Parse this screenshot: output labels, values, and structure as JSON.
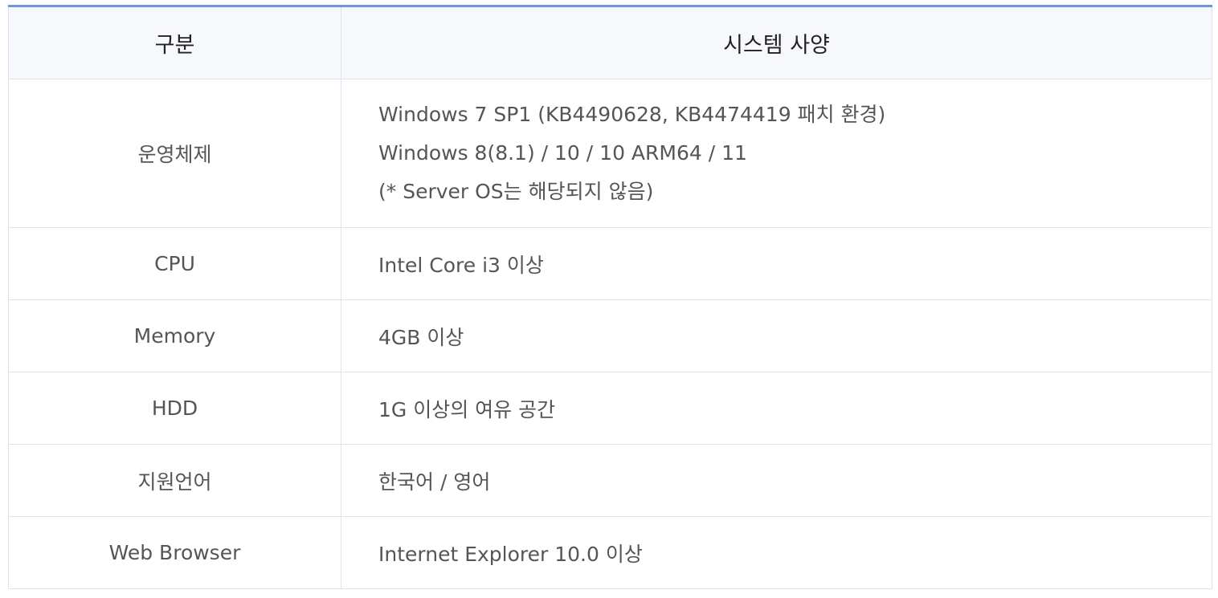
{
  "table": {
    "headers": [
      "구분",
      "시스템 사양"
    ],
    "rows": [
      {
        "label": "운영체제",
        "lines": [
          "Windows 7 SP1 (KB4490628, KB4474419 패치 환경)",
          "Windows 8(8.1) / 10 / 10 ARM64 / 11",
          "(* Server OS는 해당되지 않음)"
        ]
      },
      {
        "label": "CPU",
        "value": "Intel Core i3 이상"
      },
      {
        "label": "Memory",
        "value": "4GB 이상"
      },
      {
        "label": "HDD",
        "value": "1G 이상의 여유 공간"
      },
      {
        "label": "지원언어",
        "value": "한국어 / 영어"
      },
      {
        "label": "Web Browser",
        "value": "Internet Explorer 10.0 이상"
      }
    ]
  },
  "colors": {
    "top_border": "#7596c8",
    "header_bg": "#f6f8fc",
    "grid": "#dfe3ea",
    "body_text": "#555555"
  }
}
